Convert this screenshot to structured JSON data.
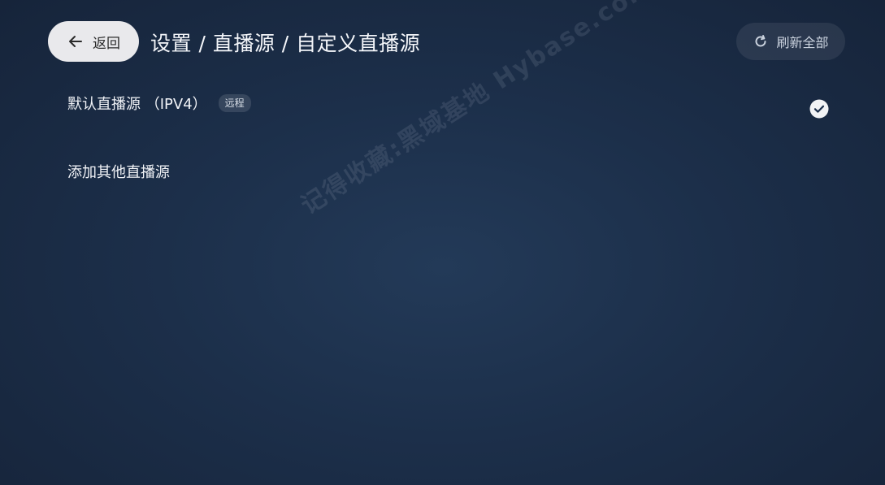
{
  "header": {
    "back_label": "返回",
    "breadcrumb": "设置 / 直播源 / 自定义直播源",
    "refresh_label": "刷新全部"
  },
  "sources": [
    {
      "name": "默认直播源 （IPV4）",
      "badge": "远程",
      "selected": true
    }
  ],
  "add_source_label": "添加其他直播源",
  "watermark": "记得收藏:黑域基地 Hybase.com",
  "icons": {
    "back": "arrow-left-icon",
    "refresh": "refresh-icon",
    "selected": "check-circle-icon"
  },
  "colors": {
    "back_button_bg": "#e9e9ec",
    "background": "#1c2f4a"
  }
}
